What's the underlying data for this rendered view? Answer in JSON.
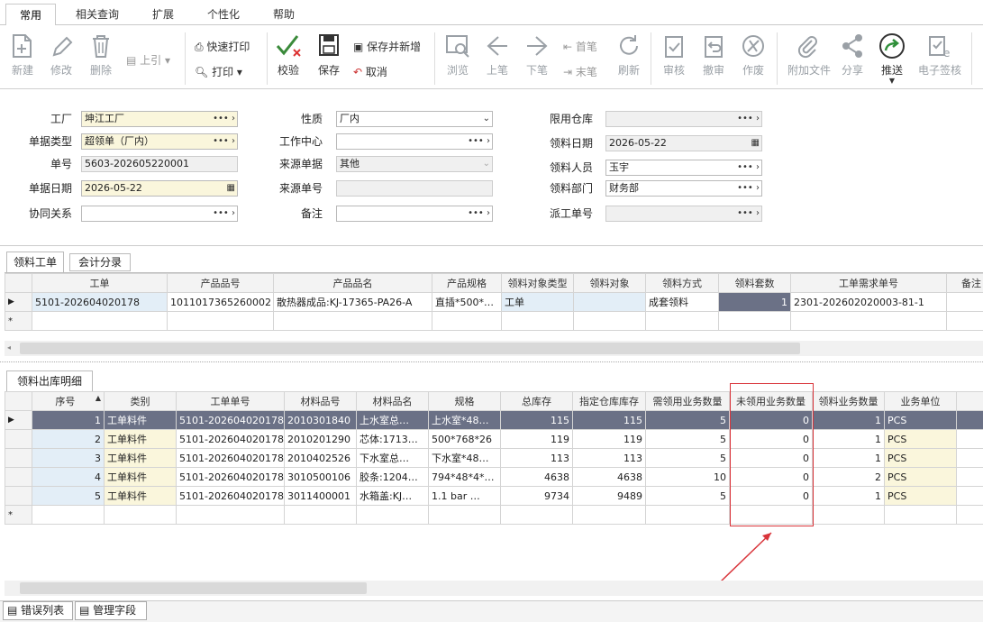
{
  "tabs": [
    "常用",
    "相关查询",
    "扩展",
    "个性化",
    "帮助"
  ],
  "toolbar": {
    "new": "新建",
    "edit": "修改",
    "delete": "删除",
    "prev_load": "上引",
    "quick_print": "快速打印",
    "print": "打印",
    "check": "校验",
    "save": "保存",
    "save_new": "保存并新增",
    "cancel": "取消",
    "browse": "浏览",
    "prev": "上笔",
    "next": "下笔",
    "first": "首笔",
    "last": "末笔",
    "refresh": "刷新",
    "audit": "审核",
    "unaudit": "撤审",
    "void": "作废",
    "attach": "附加文件",
    "share": "分享",
    "push": "推送",
    "esign": "电子签核"
  },
  "form": {
    "factory_label": "工厂",
    "factory": "坤江工厂",
    "doctype_label": "单据类型",
    "doctype": "超领单（厂内）",
    "docno_label": "单号",
    "docno": "5603-202605220001",
    "docdate_label": "单据日期",
    "docdate": "2026-05-22",
    "collab_label": "协同关系",
    "collab": "",
    "nature_label": "性质",
    "nature": "厂内",
    "workcenter_label": "工作中心",
    "workcenter": "",
    "srcdoc_label": "来源单据",
    "srcdoc": "其他",
    "srcno_label": "来源单号",
    "srcno": "",
    "remark_label": "备注",
    "remark": "",
    "limitwh_label": "限用仓库",
    "limitwh": "",
    "pickdate_label": "领料日期",
    "pickdate": "2026-05-22",
    "picker_label": "领料人员",
    "picker": "玉宇",
    "pickdept_label": "领料部门",
    "pickdept": "财务部",
    "dispatch_label": "派工单号",
    "dispatch": ""
  },
  "upper_tabs": [
    "领料工单",
    "会计分录"
  ],
  "upper_grid": {
    "headers": [
      "工单",
      "产品品号",
      "产品品名",
      "产品规格",
      "领料对象类型",
      "领料对象",
      "领料方式",
      "领料套数",
      "工单需求单号",
      "备注"
    ],
    "row": [
      "5101-202604020178",
      "1011017365260002",
      "散热器成品:KJ-17365-PA26-A",
      "直插*500*…",
      "工单",
      "",
      "成套领料",
      "1",
      "2301-202602020003-81-1",
      ""
    ]
  },
  "lower_tab": "领料出库明细",
  "lower_grid": {
    "headers": [
      "序号",
      "类别",
      "工单单号",
      "材料品号",
      "材料品名",
      "规格",
      "总库存",
      "指定仓库库存",
      "需领用业务数量",
      "未领用业务数量",
      "领料业务数量",
      "业务单位"
    ],
    "rows": [
      [
        "1",
        "工单料件",
        "5101-202604020178",
        "2010301840",
        "上水室总…",
        "上水室*48…",
        "115",
        "115",
        "5",
        "0",
        "1",
        "PCS"
      ],
      [
        "2",
        "工单料件",
        "5101-202604020178",
        "2010201290",
        "芯体:1713…",
        "500*768*26",
        "119",
        "119",
        "5",
        "0",
        "1",
        "PCS"
      ],
      [
        "3",
        "工单料件",
        "5101-202604020178",
        "2010402526",
        "下水室总…",
        "下水室*48…",
        "113",
        "113",
        "5",
        "0",
        "1",
        "PCS"
      ],
      [
        "4",
        "工单料件",
        "5101-202604020178",
        "3010500106",
        "胶条:1204…",
        "794*48*4*…",
        "4638",
        "4638",
        "10",
        "0",
        "2",
        "PCS"
      ],
      [
        "5",
        "工单料件",
        "5101-202604020178",
        "3011400001",
        "水箱盖:KJ…",
        "1.1 bar  …",
        "9734",
        "9489",
        "5",
        "0",
        "1",
        "PCS"
      ]
    ]
  },
  "bottom_tabs": [
    "错误列表",
    "管理字段"
  ],
  "colors": {
    "highlight": "#d9343a",
    "selected_row": "#6b7186",
    "yellow_cell": "#faf6dc"
  }
}
